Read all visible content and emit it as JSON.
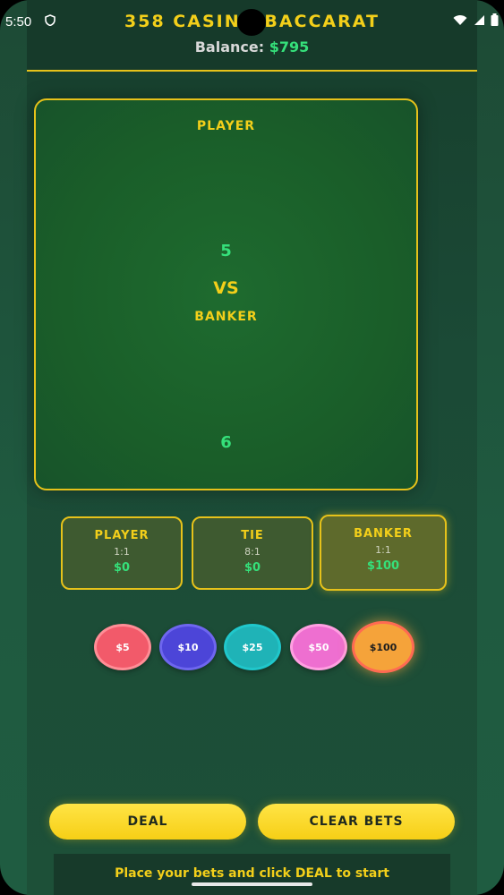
{
  "status_bar": {
    "time": "5:50",
    "icons": [
      "shield-icon",
      "wifi-icon",
      "signal-icon",
      "battery-icon"
    ]
  },
  "header": {
    "title": "358 CASINO BACCARAT",
    "balance_label": "Balance:",
    "balance_value": "$795"
  },
  "table": {
    "player_label": "PLAYER",
    "player_score": "5",
    "vs_label": "VS",
    "banker_label": "BANKER",
    "banker_score": "6"
  },
  "bets": [
    {
      "name": "PLAYER",
      "odds": "1:1",
      "amount": "$0"
    },
    {
      "name": "TIE",
      "odds": "8:1",
      "amount": "$0"
    },
    {
      "name": "BANKER",
      "odds": "1:1",
      "amount": "$100",
      "selected": true
    }
  ],
  "chips": [
    {
      "label": "$5",
      "color": "#f25a6a"
    },
    {
      "label": "$10",
      "color": "#4c45d8"
    },
    {
      "label": "$25",
      "color": "#1fb3b7"
    },
    {
      "label": "$50",
      "color": "#ee6fd0"
    },
    {
      "label": "$100",
      "color": "#f5a33a",
      "selected": true
    }
  ],
  "buttons": {
    "deal": "DEAL",
    "clear": "CLEAR BETS"
  },
  "footer": {
    "message": "Place your bets and click DEAL to start"
  },
  "colors": {
    "accent_gold": "#f3cf1a",
    "money_green": "#35e07a",
    "felt_green": "#1e6b2f"
  }
}
